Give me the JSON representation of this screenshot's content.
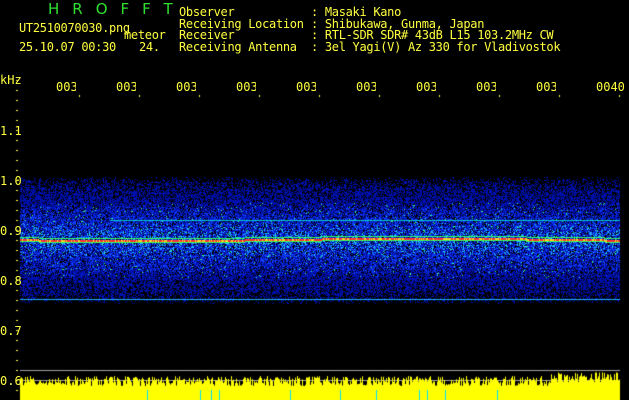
{
  "header": {
    "title": "HROFFT",
    "filename": "UT2510070030.png",
    "mode": "meteor",
    "datetime": "25.10.07 00:30",
    "count": "24.",
    "info": [
      {
        "label": "Observer",
        "value": ": Masaki Kano"
      },
      {
        "label": "Receiving Location",
        "value": ": Shibukawa, Gunma, Japan"
      },
      {
        "label": "Receiver",
        "value": ": RTL-SDR SDR# 43dB L15 103.2MHz CW"
      },
      {
        "label": "Receiving Antenna",
        "value": ": 3el Yagi(V) Az 330 for Vladivostok"
      }
    ]
  },
  "axis": {
    "unit": "kHz",
    "y_labels": [
      "1.1",
      "1.0",
      "0.9",
      "0.8",
      "0.7",
      "0.6"
    ],
    "time_labels": [
      "0031",
      "0032",
      "0033",
      "0034",
      "0035",
      "0036",
      "0037",
      "0038",
      "0039",
      "0040"
    ]
  },
  "colors": {
    "text": "#ffff40",
    "title": "#30e030",
    "signal": "#ff3030",
    "noise": "#0020ff",
    "bars": "#ffff00"
  }
}
